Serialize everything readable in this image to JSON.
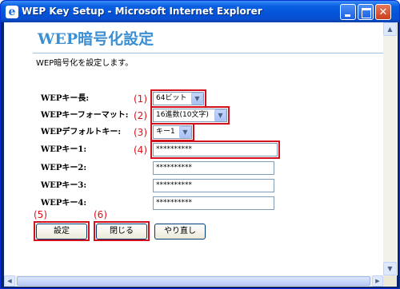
{
  "window": {
    "title": "WEP Key Setup - Microsoft Internet Explorer"
  },
  "page": {
    "title": "WEP暗号化設定",
    "description": "WEP暗号化を設定します。"
  },
  "fields": {
    "key_length": {
      "label": "WEPキー長:",
      "marker": "(1)",
      "value": "64ビット"
    },
    "key_format": {
      "label": "WEPキーフォーマット:",
      "marker": "(2)",
      "value": "16進数(10文字)"
    },
    "default_key": {
      "label": "WEPデフォルトキー:",
      "marker": "(3)",
      "value": "キー1"
    },
    "keys": [
      {
        "label": "WEPキー1:",
        "marker": "(4)",
        "value": "**********"
      },
      {
        "label": "WEPキー2:",
        "value": "**********"
      },
      {
        "label": "WEPキー3:",
        "value": "**********"
      },
      {
        "label": "WEPキー4:",
        "value": "**********"
      }
    ]
  },
  "buttons": {
    "set": {
      "label": "設定",
      "marker": "(5)"
    },
    "close": {
      "label": "閉じる",
      "marker": "(6)"
    },
    "reset": {
      "label": "やり直し"
    }
  },
  "colors": {
    "annotation": "#d4101c",
    "title": "#3c8fd3"
  }
}
